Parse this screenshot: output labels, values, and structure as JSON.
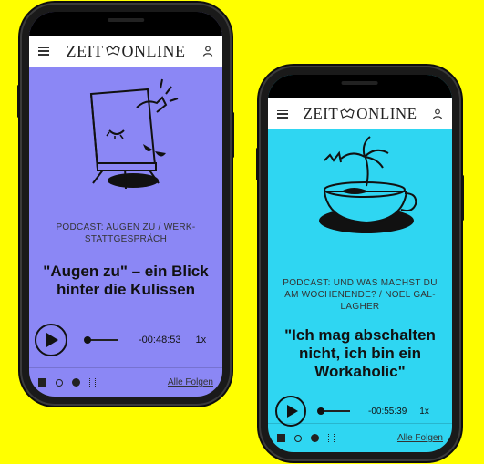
{
  "colors": {
    "background": "#ffff00",
    "phone1_screen": "#8b87f5",
    "phone2_screen": "#2fd6f2",
    "ink": "#111111"
  },
  "phone1": {
    "logo_text_left": "ZEIT",
    "logo_text_right": "ONLINE",
    "kicker_line1": "PODCAST: AUGEN ZU / WERK-",
    "kicker_line2": "STATTGESPRÄCH",
    "headline_line1": "\"Augen zu\" – ein Blick",
    "headline_line2": "hinter die Kulissen",
    "time": "-00:48:53",
    "speed": "1x",
    "all_episodes": "Alle Folgen",
    "progress": 0.0
  },
  "phone2": {
    "logo_text_left": "ZEIT",
    "logo_text_right": "ONLINE",
    "kicker_line1": "PODCAST: UND WAS MACHST DU",
    "kicker_line2": "AM WOCHENENDE? / NOEL GAL-",
    "kicker_line3": "LAGHER",
    "headline_line1": "\"Ich mag abschalten",
    "headline_line2": "nicht, ich bin ein",
    "headline_line3": "Workaholic\"",
    "time": "-00:55:39",
    "speed": "1x",
    "all_episodes": "Alle Folgen",
    "progress": 0.0
  },
  "icons": [
    "menu-icon",
    "zeit-eagle-icon",
    "user-icon",
    "play-icon",
    "deezer-icon",
    "apple-podcasts-icon",
    "spotify-icon",
    "google-podcasts-icon"
  ]
}
